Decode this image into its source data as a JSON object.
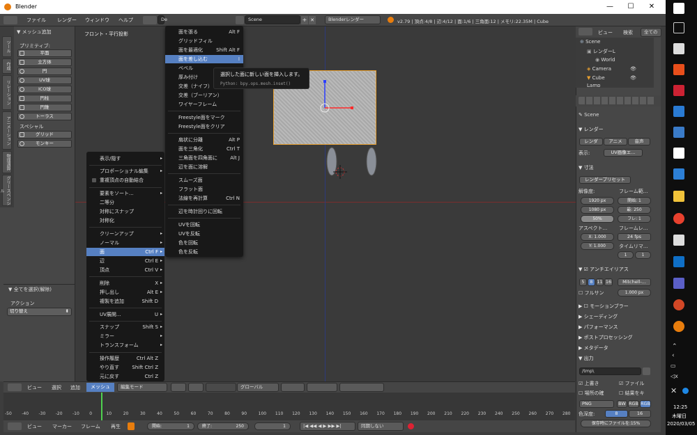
{
  "window": {
    "title": "Blender",
    "min": "—",
    "max": "☐",
    "close": "✕"
  },
  "menubar": {
    "items": [
      "ファイル",
      "レンダー",
      "ウィンドウ",
      "ヘルプ"
    ],
    "layout": "De",
    "scene": "Scene",
    "engine": "Blenderレンダー",
    "stats": "v2.79 | 頂点:4/8 | 辺:4/12 | 面:1/6 | 三角面:12 | メモリ:22.35M | Cube"
  },
  "toolshelf": {
    "tabs": [
      "ツール",
      "作成",
      "リレーション",
      "アニメーション",
      "物理演算",
      "グリースペンシル"
    ],
    "panel_title": "メッシュ追加",
    "primitive_label": "プリミティブ:",
    "primitives": [
      "平面",
      "立方体",
      "円",
      "UV球",
      "ICO球",
      "円柱",
      "円錐",
      "トーラス"
    ],
    "special_label": "スペシャル",
    "specials": [
      "グリッド",
      "モンキー"
    ],
    "op_title": "全てを選択(解除)",
    "action_label": "アクション",
    "action_value": "切り替え"
  },
  "viewport": {
    "label": "フロント・平行投影"
  },
  "face_menu": {
    "items": [
      {
        "label": "面を張る",
        "shortcut": "Alt F"
      },
      {
        "label": "グリッドフィル",
        "shortcut": ""
      },
      {
        "label": "面を最適化",
        "shortcut": "Shift Alt F"
      },
      {
        "label": "面を差し込む",
        "shortcut": "I"
      },
      {
        "label": "ベベル",
        "shortcut": ""
      },
      {
        "label": "厚み付け",
        "shortcut": ""
      },
      {
        "label": "交差（ナイフ）",
        "shortcut": ""
      },
      {
        "label": "交差（ブーリアン）",
        "shortcut": ""
      },
      {
        "label": "ワイヤーフレーム",
        "shortcut": ""
      },
      {
        "label": "Freestyle面をマーク",
        "shortcut": ""
      },
      {
        "label": "Freestyle面をクリア",
        "shortcut": ""
      },
      {
        "label": "扇状に分離",
        "shortcut": "Alt P"
      },
      {
        "label": "面を三角化",
        "shortcut": "Ctrl T"
      },
      {
        "label": "三角面を四角面に",
        "shortcut": "Alt J"
      },
      {
        "label": "辺を面に溶解",
        "shortcut": ""
      },
      {
        "label": "スムーズ面",
        "shortcut": ""
      },
      {
        "label": "フラット面",
        "shortcut": ""
      },
      {
        "label": "法線を再計算",
        "shortcut": "Ctrl N"
      },
      {
        "label": "辺を時計回りに回転",
        "shortcut": ""
      },
      {
        "label": "UVを回転",
        "shortcut": ""
      },
      {
        "label": "UVを反転",
        "shortcut": ""
      },
      {
        "label": "色を回転",
        "shortcut": ""
      },
      {
        "label": "色を反転",
        "shortcut": ""
      }
    ]
  },
  "tooltip": {
    "text": "選択した面に新しい面を挿入します。",
    "python": "Python: bpy.ops.mesh.inset()"
  },
  "mesh_menu": {
    "items": [
      {
        "label": "表示/隠す",
        "shortcut": "",
        "arrow": "▸"
      },
      {
        "label": "プロポーショナル編集",
        "shortcut": "",
        "arrow": "▸"
      },
      {
        "label": "重複頂点の自動結合",
        "shortcut": "",
        "arrow": ""
      },
      {
        "label": "要素をソート...",
        "shortcut": "",
        "arrow": "▸"
      },
      {
        "label": "二等分",
        "shortcut": "",
        "arrow": ""
      },
      {
        "label": "対称にスナップ",
        "shortcut": "",
        "arrow": ""
      },
      {
        "label": "対称化",
        "shortcut": "",
        "arrow": ""
      },
      {
        "label": "クリーンアップ",
        "shortcut": "",
        "arrow": "▸"
      },
      {
        "label": "ノーマル",
        "shortcut": "",
        "arrow": "▸"
      },
      {
        "label": "面",
        "shortcut": "Ctrl F",
        "arrow": "▸"
      },
      {
        "label": "辺",
        "shortcut": "Ctrl E",
        "arrow": "▸"
      },
      {
        "label": "頂点",
        "shortcut": "Ctrl V",
        "arrow": "▸"
      },
      {
        "label": "削除",
        "shortcut": "X",
        "arrow": "▸"
      },
      {
        "label": "押し出し",
        "shortcut": "Alt E",
        "arrow": "▸"
      },
      {
        "label": "複製を追加",
        "shortcut": "Shift D",
        "arrow": ""
      },
      {
        "label": "UV展開...",
        "shortcut": "U",
        "arrow": "▸"
      },
      {
        "label": "スナップ",
        "shortcut": "Shift S",
        "arrow": "▸"
      },
      {
        "label": "ミラー",
        "shortcut": "",
        "arrow": "▸"
      },
      {
        "label": "トランスフォーム",
        "shortcut": "",
        "arrow": "▸"
      },
      {
        "label": "操作履歴",
        "shortcut": "Ctrl Alt Z",
        "arrow": ""
      },
      {
        "label": "やり直す",
        "shortcut": "Shift Ctrl Z",
        "arrow": ""
      },
      {
        "label": "元に戻す",
        "shortcut": "Ctrl Z",
        "arrow": ""
      }
    ]
  },
  "header3d": {
    "view": "ビュー",
    "select": "選択",
    "add": "追加",
    "mesh": "メッシュ",
    "mode": "編集モード",
    "orientation": "グローバル"
  },
  "timeline": {
    "ticks": [
      "-50",
      "-40",
      "-30",
      "-20",
      "-10",
      "0",
      "10",
      "20",
      "30",
      "40",
      "50",
      "60",
      "70",
      "80",
      "90",
      "100",
      "110",
      "120",
      "130",
      "140",
      "150",
      "160",
      "170",
      "180",
      "190",
      "200",
      "210",
      "220",
      "230",
      "240",
      "250",
      "260",
      "270",
      "280"
    ],
    "view": "ビュー",
    "marker": "マーカー",
    "frame": "フレーム",
    "playback": "再生",
    "start_label": "開始:",
    "start": "1",
    "end_label": "終了:",
    "end": "250",
    "current": "1",
    "sync": "同期しない"
  },
  "outliner": {
    "view": "ビュー",
    "search": "検索",
    "filter": "全てのシ",
    "items": [
      "Scene",
      "レンダーL",
      "World",
      "Camera",
      "Cube",
      "Lamp"
    ]
  },
  "properties": {
    "scene": "Scene",
    "render_panel": "レンダー",
    "render_btns": [
      "レンダ",
      "アニメ",
      "音声"
    ],
    "display_label": "表示:",
    "display_value": "UV画像エ...",
    "dimensions": "寸法",
    "preset": "レンダープリセット",
    "resolution": "解像度:",
    "frame_range": "フレーム範...",
    "res_x": "1920 px",
    "res_y": "1080 px",
    "res_pct": "50%",
    "start": "開始: 1",
    "end": "最: 250",
    "step": "フレ: 1",
    "aspect": "アスペクト...",
    "frame_rate": "フレームレ...",
    "asp_x": "X: 1.000",
    "asp_y": "Y: 1.000",
    "fps": "24 fps",
    "time_remap": "タイムリマ...",
    "remap_a": "1",
    "remap_b": "1",
    "aa": "アンチエイリアス",
    "aa_levels": [
      "5",
      "8",
      "11",
      "16"
    ],
    "aa_filter": "Mitchell-...",
    "full_sample": "フルサン",
    "filter_size": "1.000 px",
    "collapsed": [
      "モーションブラー",
      "シェーディング",
      "パフォーマンス",
      "ポストプロセッシング",
      "メタデータ"
    ],
    "output": "出力",
    "path": "/tmp\\",
    "overwrite": "上書き",
    "file_ext": "ファイル",
    "placeholders": "場所の確",
    "cache": "結果をキ",
    "format": "PNG",
    "bw": "BW",
    "rgb": "RGB",
    "rgba": "RGB",
    "depth_label": "色深度:",
    "depth_8": "8",
    "depth_16": "16",
    "compress": "保存時にファイルを:15%"
  },
  "taskbar": {
    "time": "12:25",
    "weekday": "木曜日",
    "date": "2020/03/05"
  },
  "colors": {
    "accent": "#5680c2",
    "selection": "#e8a030",
    "bg": "#3d3d3d"
  }
}
